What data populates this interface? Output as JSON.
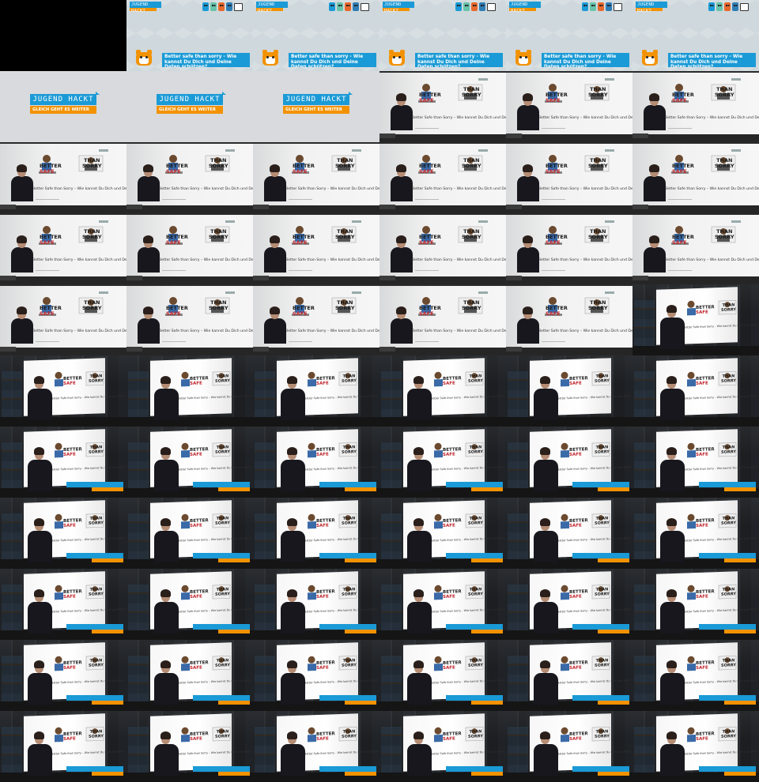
{
  "title_card": {
    "logo_text": "JUGEND HACKT",
    "talk_title": "Better safe than sorry - Wie kannst Du Dich und Deine Daten schützen?"
  },
  "wait_screen": {
    "logo_text": "JUGEND HACKT",
    "subtitle": "GLEICH GEHT ES WEITER"
  },
  "slide": {
    "word_better": "BETTER",
    "word_safe": "SAFE",
    "word_than": "THAN",
    "word_sorry": "SORRY",
    "subtitle": "Better Safe than Sorry – Wie kannst Du Dich und Deine Daten besser schützen"
  },
  "colors": {
    "brand_blue": "#1a9ad6",
    "brand_orange": "#f39200"
  },
  "layout_rows": [
    [
      "blank",
      "title",
      "title",
      "title",
      "title",
      "title"
    ],
    [
      "wait",
      "wait",
      "wait",
      "front",
      "front",
      "front"
    ],
    [
      "front",
      "front",
      "front",
      "front",
      "front",
      "front"
    ],
    [
      "front",
      "front",
      "front",
      "front",
      "front",
      "front"
    ],
    [
      "front",
      "front",
      "front",
      "front",
      "front",
      "side"
    ],
    [
      "side",
      "side",
      "side",
      "side",
      "side",
      "side"
    ],
    [
      "side",
      "side",
      "side",
      "side",
      "side",
      "side"
    ],
    [
      "side",
      "side",
      "side",
      "side",
      "side",
      "side"
    ],
    [
      "side",
      "side",
      "side",
      "side",
      "side",
      "side"
    ],
    [
      "side",
      "side",
      "side",
      "side",
      "side",
      "side"
    ],
    [
      "side",
      "side",
      "side",
      "side",
      "side",
      "side"
    ]
  ]
}
